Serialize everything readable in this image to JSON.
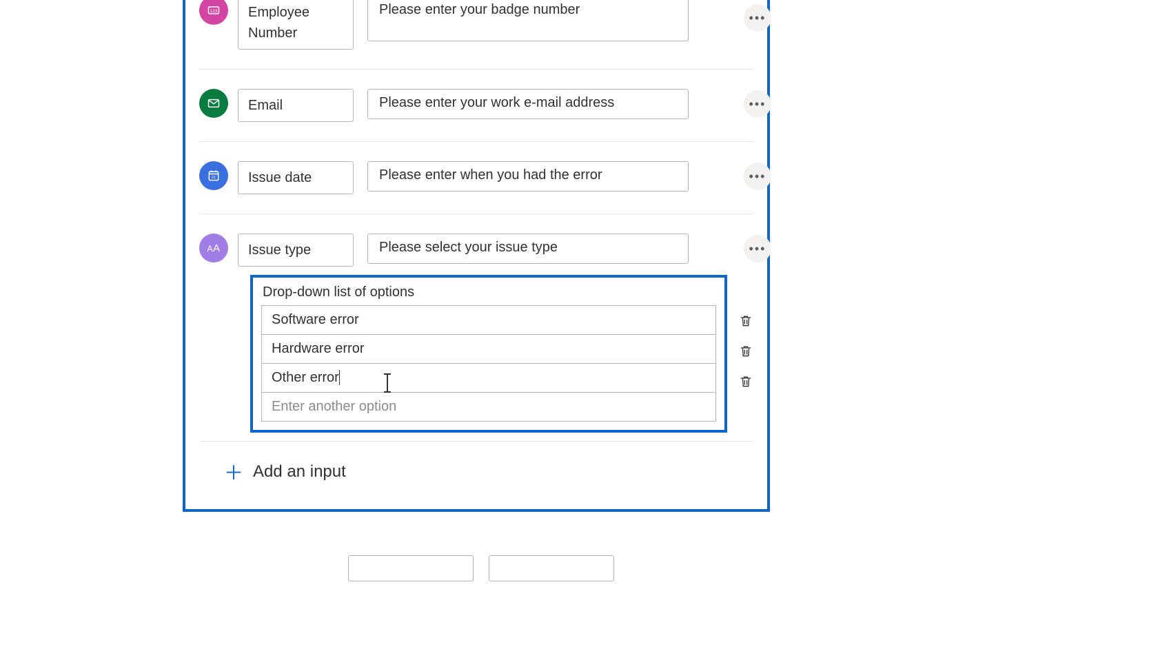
{
  "inputs": [
    {
      "icon": "number",
      "iconColor": "#d444a2",
      "title": "Employee Number",
      "description": "Please enter your badge number",
      "moreTop": 22
    },
    {
      "icon": "email",
      "iconColor": "#0a7b3e",
      "title": "Email",
      "description": "Please enter your work e-mail address",
      "moreTop": 30
    },
    {
      "icon": "date",
      "iconColor": "#3a6fe0",
      "title": "Issue date",
      "description": "Please enter when you had the error",
      "moreTop": 30
    },
    {
      "icon": "text",
      "iconColor": "#a17de6",
      "title": "Issue type",
      "description": "Please select your issue type",
      "moreTop": 30
    }
  ],
  "dropdown": {
    "title": "Drop-down list of options",
    "options": [
      "Software error",
      "Hardware error",
      "Other error"
    ],
    "placeholder": "Enter another option"
  },
  "addInputLabel": "Add an input"
}
